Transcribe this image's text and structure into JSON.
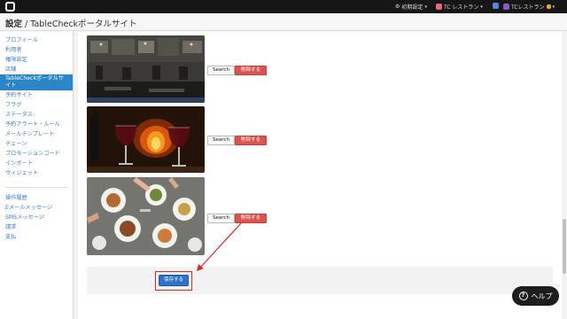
{
  "topbar": {
    "initial_settings": "初期設定",
    "restaurant_a": "TC レストラン",
    "restaurant_b": "TCレストラン"
  },
  "header": {
    "title_bold": "設定",
    "title_rest": " / TableCheckポータルサイト"
  },
  "sidebar": {
    "items": [
      {
        "label": "プロフィール"
      },
      {
        "label": "利用者"
      },
      {
        "label": "権限設定"
      },
      {
        "label": "店舗"
      },
      {
        "label": "TableCheckポータルサイト"
      },
      {
        "label": "予約サイト"
      },
      {
        "label": "フラグ"
      },
      {
        "label": "ステータス"
      },
      {
        "label": "予約アラート・ルール"
      },
      {
        "label": "メールテンプレート"
      },
      {
        "label": "チェーン"
      },
      {
        "label": "プロモーションコード"
      },
      {
        "label": "インポート"
      },
      {
        "label": "ウィジェット"
      }
    ],
    "secondary": [
      {
        "label": "操作履歴"
      },
      {
        "label": "Eメールメッセージ"
      },
      {
        "label": "SMSメッセージ"
      },
      {
        "label": "請求"
      },
      {
        "label": "支払"
      }
    ]
  },
  "gallery": {
    "search_label": "Search",
    "delete_label": "削除する"
  },
  "footer": {
    "save_label": "保存する"
  },
  "help": {
    "label": "ヘルプ",
    "icon_glyph": "?"
  },
  "colors": {
    "topbar": "#161616",
    "active_nav": "#2a86c7",
    "link": "#3d7cc9",
    "delete": "#d9534f",
    "save": "#2f70c8",
    "annotation": "#e0262b"
  }
}
